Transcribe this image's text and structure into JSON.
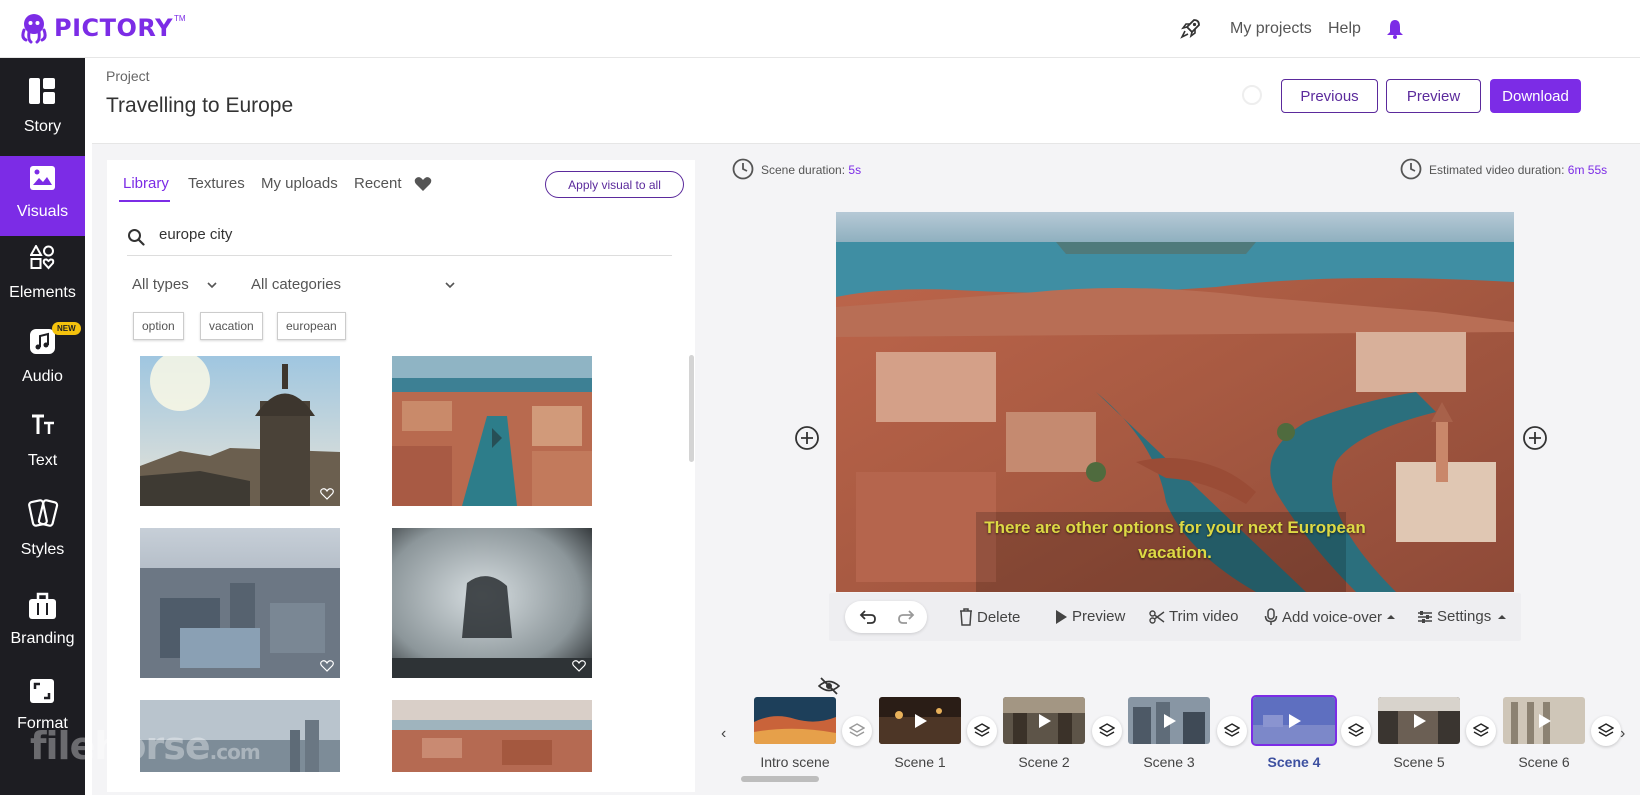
{
  "app": {
    "logo_text": "PICTORY",
    "logo_tm": "TM"
  },
  "topnav": {
    "my_projects": "My projects",
    "help": "Help"
  },
  "sidebar": {
    "items": [
      {
        "label": "Story",
        "icon": "layout-icon"
      },
      {
        "label": "Visuals",
        "icon": "image-icon",
        "active": true
      },
      {
        "label": "Elements",
        "icon": "shapes-icon"
      },
      {
        "label": "Audio",
        "icon": "music-icon",
        "badge": "NEW"
      },
      {
        "label": "Text",
        "icon": "text-icon"
      },
      {
        "label": "Styles",
        "icon": "styles-icon"
      },
      {
        "label": "Branding",
        "icon": "briefcase-icon"
      },
      {
        "label": "Format",
        "icon": "format-icon"
      }
    ]
  },
  "project": {
    "label": "Project",
    "title": "Travelling to Europe",
    "previous_label": "Previous",
    "preview_label": "Preview",
    "download_label": "Download"
  },
  "library": {
    "tabs": [
      "Library",
      "Textures",
      "My uploads",
      "Recent"
    ],
    "active_tab": "Library",
    "apply_label": "Apply visual to all",
    "search_value": "europe city",
    "type_filter": "All types",
    "category_filter": "All categories",
    "chips": [
      "option",
      "vacation",
      "european"
    ]
  },
  "scene_info": {
    "duration_label": "Scene duration:",
    "duration_value": "5s",
    "estimated_label": "Estimated video duration:",
    "estimated_value": "6m 55s"
  },
  "caption": "There are other options for your next European vacation.",
  "toolbar": {
    "delete": "Delete",
    "preview": "Preview",
    "trim": "Trim video",
    "voiceover": "Add voice-over",
    "settings": "Settings"
  },
  "timeline": {
    "scenes": [
      "Intro scene",
      "Scene 1",
      "Scene 2",
      "Scene 3",
      "Scene 4",
      "Scene 5",
      "Scene 6"
    ],
    "active_scene": "Scene 4"
  },
  "watermark": {
    "main": "filehorse",
    "suffix": ".com"
  },
  "colors": {
    "accent": "#7c2ce6",
    "sidebar_bg": "#1d1d22",
    "caption": "#ddd944"
  }
}
